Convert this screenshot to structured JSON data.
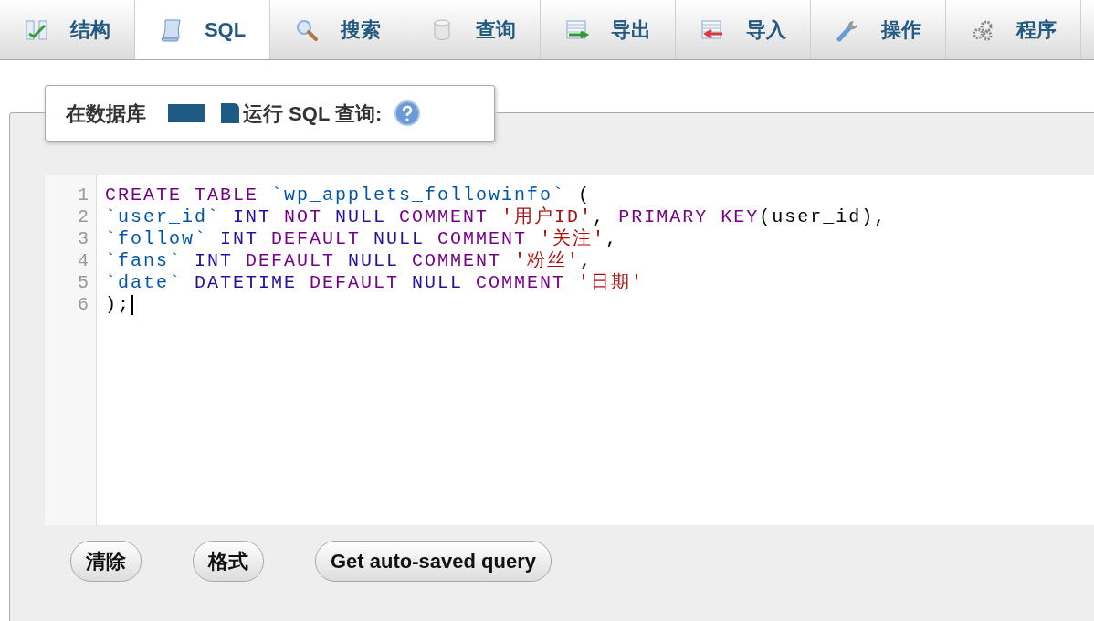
{
  "tabs": [
    {
      "label": "结构",
      "selected": false
    },
    {
      "label": "SQL",
      "selected": true
    },
    {
      "label": "搜索",
      "selected": false
    },
    {
      "label": "查询",
      "selected": false
    },
    {
      "label": "导出",
      "selected": false
    },
    {
      "label": "导入",
      "selected": false
    },
    {
      "label": "操作",
      "selected": false
    },
    {
      "label": "程序",
      "selected": false
    }
  ],
  "legend": {
    "prefix": "在数据库",
    "suffix": "运行 SQL 查询:"
  },
  "editor": {
    "lines": [
      [
        {
          "kind": "keyword",
          "text": "CREATE "
        },
        {
          "kind": "keyword",
          "text": "TABLE "
        },
        {
          "kind": "identifier",
          "text": "`wp_applets_followinfo` "
        },
        {
          "kind": "plain",
          "text": "("
        }
      ],
      [
        {
          "kind": "identifier",
          "text": "`user_id` "
        },
        {
          "kind": "type",
          "text": "INT "
        },
        {
          "kind": "keyword",
          "text": "NOT "
        },
        {
          "kind": "type",
          "text": "NULL "
        },
        {
          "kind": "keyword",
          "text": "COMMENT "
        },
        {
          "kind": "string",
          "text": "'用户ID'"
        },
        {
          "kind": "plain",
          "text": ", "
        },
        {
          "kind": "keyword",
          "text": "PRIMARY "
        },
        {
          "kind": "keyword",
          "text": "KEY"
        },
        {
          "kind": "plain",
          "text": "(user_id),"
        }
      ],
      [
        {
          "kind": "identifier",
          "text": "`follow` "
        },
        {
          "kind": "type",
          "text": "INT "
        },
        {
          "kind": "keyword",
          "text": "DEFAULT "
        },
        {
          "kind": "type",
          "text": "NULL "
        },
        {
          "kind": "keyword",
          "text": "COMMENT "
        },
        {
          "kind": "string",
          "text": "'关注'"
        },
        {
          "kind": "plain",
          "text": ","
        }
      ],
      [
        {
          "kind": "identifier",
          "text": "`fans` "
        },
        {
          "kind": "type",
          "text": "INT "
        },
        {
          "kind": "keyword",
          "text": "DEFAULT "
        },
        {
          "kind": "type",
          "text": "NULL "
        },
        {
          "kind": "keyword",
          "text": "COMMENT "
        },
        {
          "kind": "string",
          "text": "'粉丝'"
        },
        {
          "kind": "plain",
          "text": ","
        }
      ],
      [
        {
          "kind": "identifier",
          "text": "`date` "
        },
        {
          "kind": "type",
          "text": "DATETIME "
        },
        {
          "kind": "keyword",
          "text": "DEFAULT "
        },
        {
          "kind": "type",
          "text": "NULL "
        },
        {
          "kind": "keyword",
          "text": "COMMENT "
        },
        {
          "kind": "string",
          "text": "'日期'"
        }
      ],
      [
        {
          "kind": "plain",
          "text": ");"
        }
      ]
    ],
    "line_numbers": [
      "1",
      "2",
      "3",
      "4",
      "5",
      "6"
    ]
  },
  "buttons": [
    "清除",
    "格式",
    "Get auto-saved query"
  ]
}
